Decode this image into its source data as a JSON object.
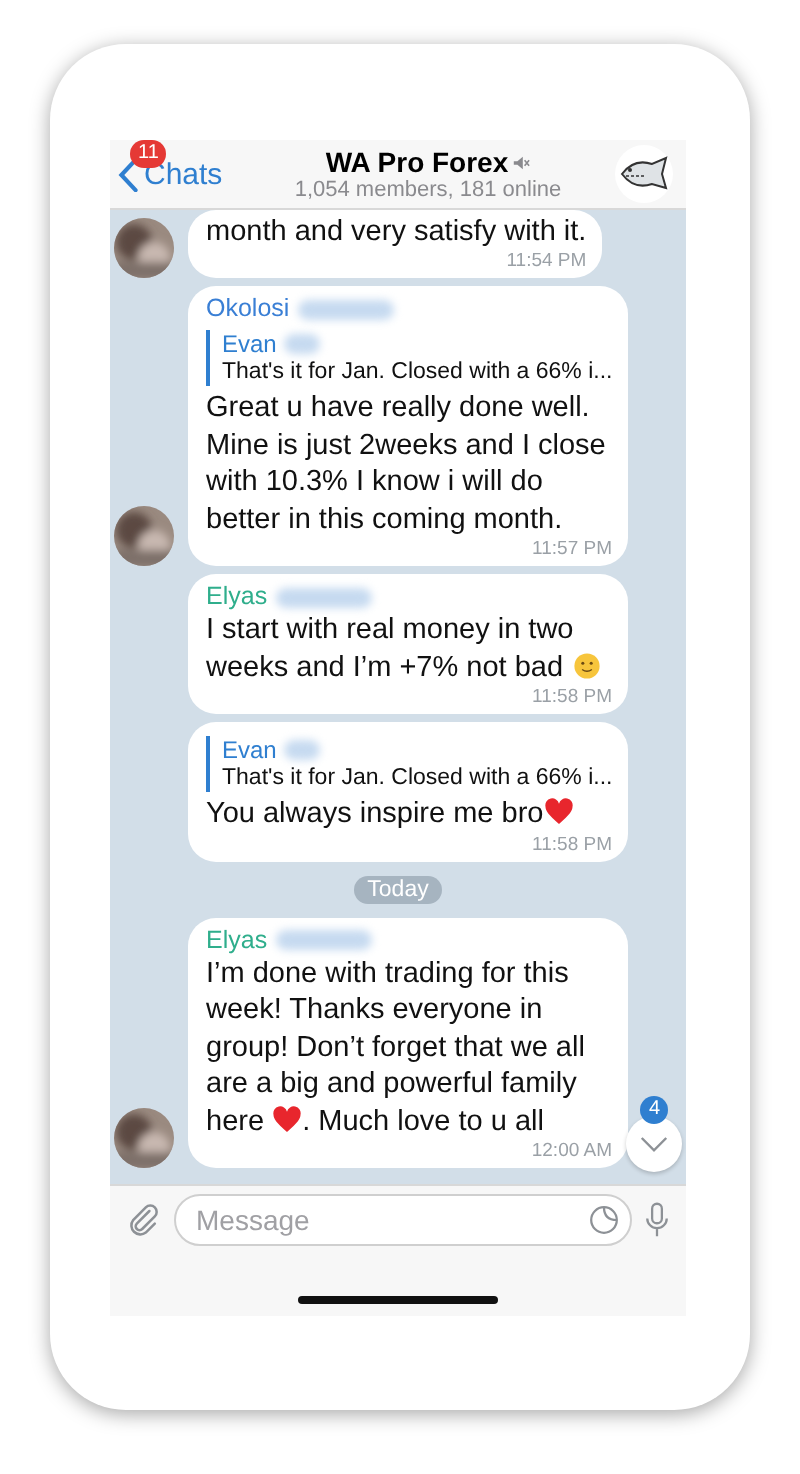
{
  "header": {
    "back_label": "Chats",
    "unread_badge": "11",
    "title": "WA Pro Forex",
    "muted": true,
    "subtitle": "1,054 members, 181 online"
  },
  "timeline": [
    {
      "kind": "message",
      "avatar": true,
      "body": [
        {
          "kind": "text",
          "text": "month and very satisfy with it."
        }
      ],
      "time": "11:54 PM"
    },
    {
      "kind": "message",
      "avatar": true,
      "sender": {
        "name": "Okolosi",
        "color": "#3a7fd5",
        "redacted": true
      },
      "reply": {
        "name": "Evan",
        "redacted": true,
        "text": "That's it for Jan. Closed with a 66% i..."
      },
      "body": [
        {
          "kind": "text",
          "text": "Great u have really done well. Mine is just 2weeks and I close with 10.3% I know i will do better in this coming month."
        }
      ],
      "time": "11:57 PM"
    },
    {
      "kind": "message",
      "avatar": false,
      "sender": {
        "name": "Elyas",
        "color": "#2fae8c",
        "redacted": true
      },
      "body": [
        {
          "kind": "text",
          "text": "I start with real money in two weeks and I’m +7% not bad "
        },
        {
          "kind": "smile"
        }
      ],
      "time": "11:58 PM"
    },
    {
      "kind": "message",
      "avatar": false,
      "reply": {
        "name": "Evan",
        "redacted": true,
        "text": "That's it for Jan. Closed with a 66% i..."
      },
      "body": [
        {
          "kind": "text",
          "text": "You always inspire me bro"
        },
        {
          "kind": "heart"
        }
      ],
      "time": "11:58 PM"
    },
    {
      "kind": "date",
      "text": "Today"
    },
    {
      "kind": "message",
      "avatar": true,
      "sender": {
        "name": "Elyas",
        "color": "#2fae8c",
        "redacted": true
      },
      "body": [
        {
          "kind": "text",
          "text": "I’m done with trading for this week! Thanks everyone in group! Don’t forget that we all are a big and powerful family here "
        },
        {
          "kind": "heart"
        },
        {
          "kind": "text",
          "text": ". Much love to u all"
        }
      ],
      "time": "12:00 AM"
    }
  ],
  "scroll_down_badge": "4",
  "composer": {
    "placeholder": "Message"
  }
}
